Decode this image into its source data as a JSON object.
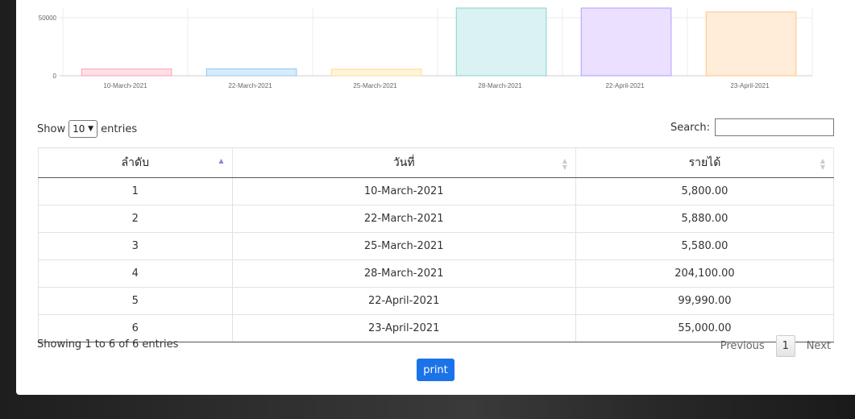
{
  "chart_data": {
    "type": "bar",
    "categories": [
      "10-March-2021",
      "22-March-2021",
      "25-March-2021",
      "28-March-2021",
      "22-April-2021",
      "23-April-2021"
    ],
    "values": [
      5800,
      5880,
      5580,
      204100,
      99990,
      55000
    ],
    "y_ticks": [
      "0",
      "50000"
    ],
    "ylim": [
      0,
      75000
    ],
    "colors": {
      "fill": [
        "#ffe0e6",
        "#d7ecfb",
        "#fff5dd",
        "#dbf2f2",
        "#ebe0ff",
        "#ffecd9"
      ],
      "stroke": [
        "#ff9fb3",
        "#8fc7f0",
        "#ffd98a",
        "#86d0d0",
        "#b49bff",
        "#ffc38a"
      ]
    },
    "grid": true
  },
  "controls": {
    "show_label": "Show",
    "entries_label": "entries",
    "length_value": "10",
    "search_label": "Search:"
  },
  "table": {
    "headers": [
      "ลำดับ",
      "วันที่",
      "รายได้"
    ],
    "rows": [
      [
        "1",
        "10-March-2021",
        "5,800.00"
      ],
      [
        "2",
        "22-March-2021",
        "5,880.00"
      ],
      [
        "3",
        "25-March-2021",
        "5,580.00"
      ],
      [
        "4",
        "28-March-2021",
        "204,100.00"
      ],
      [
        "5",
        "22-April-2021",
        "99,990.00"
      ],
      [
        "6",
        "23-April-2021",
        "55,000.00"
      ]
    ]
  },
  "footer": {
    "info": "Showing 1 to 6 of 6 entries",
    "previous": "Previous",
    "page": "1",
    "next": "Next",
    "print": "print"
  }
}
